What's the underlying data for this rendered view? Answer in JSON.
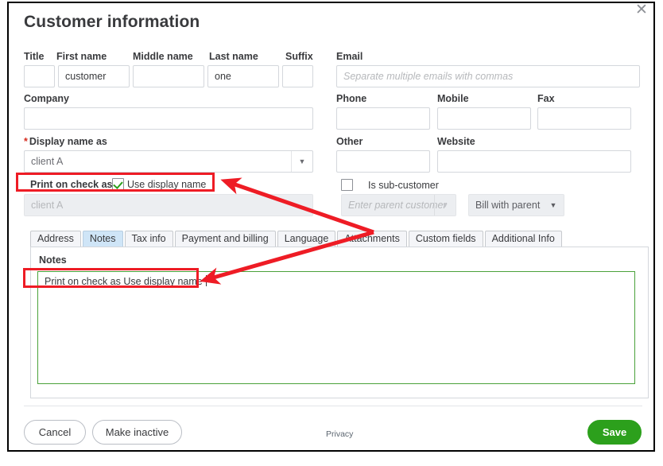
{
  "window": {
    "title": "Customer information",
    "close_icon": "close-icon",
    "close_glyph": "✕"
  },
  "name_row": {
    "fields": [
      {
        "label": "Title",
        "value": "",
        "name": "title-field"
      },
      {
        "label": "First name",
        "value": "customer",
        "name": "first-name-field"
      },
      {
        "label": "Middle name",
        "value": "",
        "name": "middle-name-field"
      },
      {
        "label": "Last name",
        "value": "one",
        "name": "last-name-field"
      },
      {
        "label": "Suffix",
        "value": "",
        "name": "suffix-field"
      }
    ]
  },
  "company": {
    "label": "Company",
    "value": ""
  },
  "display_name": {
    "label": "Display name as",
    "required": true,
    "value": "client A",
    "caret_glyph": "▼"
  },
  "print_on_check": {
    "label": "Print on check as",
    "checkbox_label": "Use display name",
    "checked": true,
    "value": "client A",
    "disabled": true
  },
  "contact": {
    "email": {
      "label": "Email",
      "value": "",
      "placeholder": "Separate multiple emails with commas"
    },
    "phone": {
      "label": "Phone",
      "value": ""
    },
    "mobile": {
      "label": "Mobile",
      "value": ""
    },
    "fax": {
      "label": "Fax",
      "value": ""
    },
    "other": {
      "label": "Other",
      "value": ""
    },
    "website": {
      "label": "Website",
      "value": ""
    }
  },
  "sub_customer": {
    "checkbox_label": "Is sub-customer",
    "checked": false,
    "parent_placeholder": "Enter parent customer",
    "bill_option": "Bill with parent",
    "caret_glyph": "▼"
  },
  "tabs": {
    "items": [
      {
        "label": "Address",
        "active": false
      },
      {
        "label": "Notes",
        "active": true
      },
      {
        "label": "Tax info",
        "active": false
      },
      {
        "label": "Payment and billing",
        "active": false
      },
      {
        "label": "Language",
        "active": false
      },
      {
        "label": "Attachments",
        "active": false
      },
      {
        "label": "Custom fields",
        "active": false
      },
      {
        "label": "Additional Info",
        "active": false
      }
    ]
  },
  "notes_panel": {
    "label": "Notes",
    "value": "Print on check as  Use display name"
  },
  "footer": {
    "cancel_label": "Cancel",
    "make_inactive_label": "Make inactive",
    "privacy_label": "Privacy",
    "save_label": "Save"
  },
  "annotation": {
    "highlight_color": "#ee1c25",
    "arrow_color": "#ee1c25"
  },
  "colors": {
    "save_green": "#2ca01c",
    "required_red": "#d52b1e",
    "tab_active": "#cfe5f7",
    "notes_border_green": "#4aa23a"
  }
}
